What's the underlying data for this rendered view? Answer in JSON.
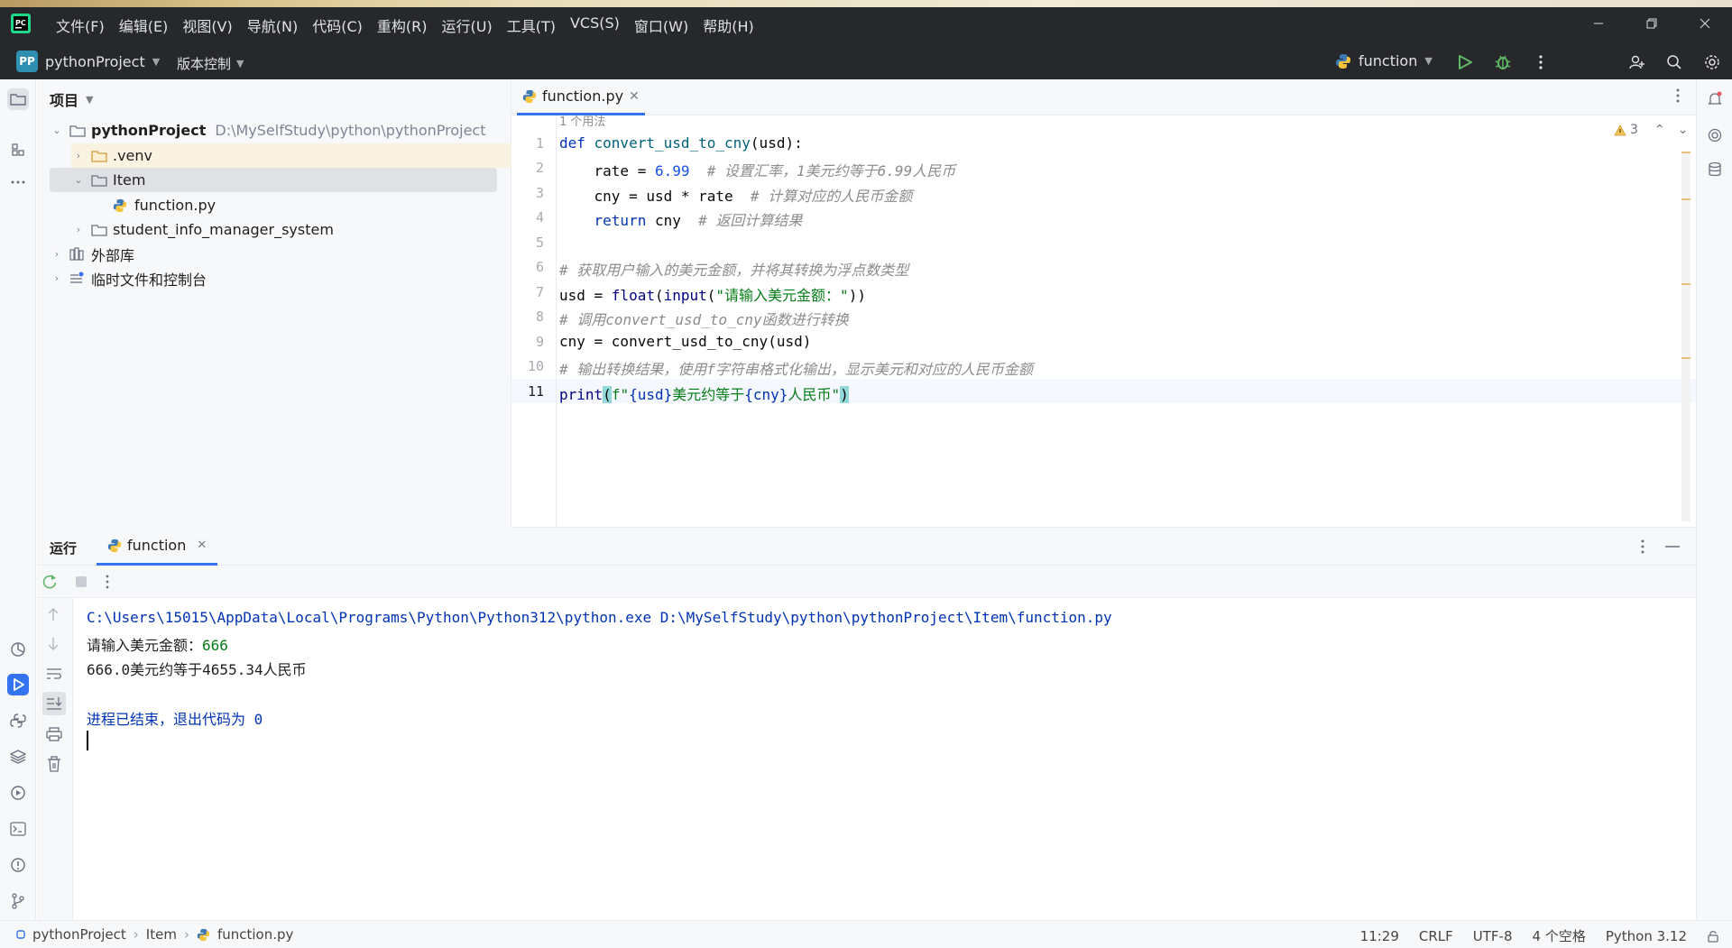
{
  "menubar": {
    "items": [
      "文件(F)",
      "编辑(E)",
      "视图(V)",
      "导航(N)",
      "代码(C)",
      "重构(R)",
      "运行(U)",
      "工具(T)",
      "VCS(S)",
      "窗口(W)",
      "帮助(H)"
    ]
  },
  "toolbar": {
    "project_avatar": "PP",
    "project_name": "pythonProject",
    "vcs_label": "版本控制",
    "run_config": "function"
  },
  "project_panel": {
    "title": "项目",
    "root": {
      "name": "pythonProject",
      "path": "D:\\MySelfStudy\\python\\pythonProject"
    },
    "items": [
      ".venv",
      "Item",
      "function.py",
      "student_info_manager_system",
      "外部库",
      "临时文件和控制台"
    ]
  },
  "editor": {
    "tab_label": "function.py",
    "usage_hint": "1 个用法",
    "warning_count": "3",
    "line_numbers": [
      "1",
      "2",
      "3",
      "4",
      "5",
      "6",
      "7",
      "8",
      "9",
      "10",
      "11"
    ],
    "lines": {
      "l1_kw": "def ",
      "l1_fn": "convert_usd_to_cny",
      "l1_rest": "(usd):",
      "l2_code": "    rate = ",
      "l2_num": "6.99",
      "l2_cmt": "  # 设置汇率，1美元约等于6.99人民币",
      "l3_code": "    cny = usd * rate",
      "l3_cmt": "  # 计算对应的人民币金额",
      "l4_kw": "    return",
      "l4_code": " cny",
      "l4_cmt": "  # 返回计算结果",
      "l6_cmt": "# 获取用户输入的美元金额，并将其转换为浮点数类型",
      "l7_code": "usd = ",
      "l7_bi1": "float",
      "l7_p1": "(",
      "l7_bi2": "input",
      "l7_p2": "(",
      "l7_str": "\"请输入美元金额：\"",
      "l7_p3": "))",
      "l8_cmt": "# 调用convert_usd_to_cny函数进行转换",
      "l9_code": "cny = convert_usd_to_cny(usd)",
      "l10_cmt": "# 输出转换结果，使用f字符串格式化输出，显示美元和对应的人民币金额",
      "l11_bi": "print",
      "l11_p1": "(",
      "l11_str1": "f\"",
      "l11_v1": "{usd}",
      "l11_str2": "美元约等于",
      "l11_v2": "{cny}",
      "l11_str3": "人民币\"",
      "l11_p2": ")"
    }
  },
  "run_panel": {
    "title": "运行",
    "tab_label": "function",
    "console": {
      "command": "C:\\Users\\15015\\AppData\\Local\\Programs\\Python\\Python312\\python.exe D:\\MySelfStudy\\python\\pythonProject\\Item\\function.py",
      "prompt": "请输入美元金额：",
      "input": "666",
      "output": "666.0美元约等于4655.34人民币",
      "exit": "进程已结束，退出代码为 0"
    }
  },
  "statusbar": {
    "breadcrumbs": [
      "pythonProject",
      "Item",
      "function.py"
    ],
    "position": "11:29",
    "line_ending": "CRLF",
    "encoding": "UTF-8",
    "indent": "4 个空格",
    "interpreter": "Python 3.12"
  },
  "colors": {
    "accent": "#3574f0",
    "titlebar_bg": "#27282c",
    "keyword": "#0033b3",
    "string": "#067d17",
    "number": "#1750eb",
    "comment": "#8c8c8c",
    "run_green": "#5fb865"
  },
  "icons": [
    "pycharm-logo-icon",
    "python-file-icon",
    "folder-icon",
    "run-icon",
    "debug-icon",
    "search-icon",
    "settings-icon",
    "add-user-icon",
    "notification-icon",
    "rerun-icon",
    "stop-icon",
    "more-icon",
    "warning-icon"
  ]
}
